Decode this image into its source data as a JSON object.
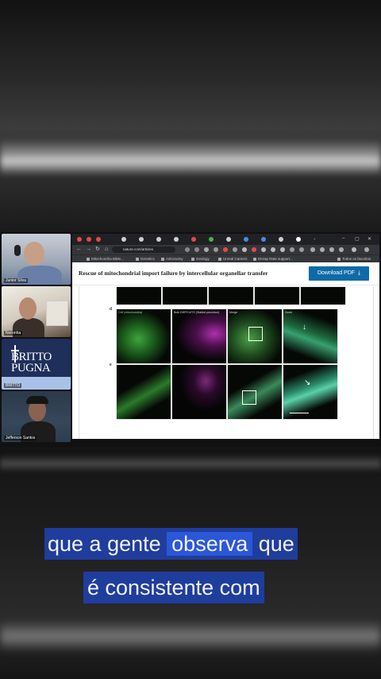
{
  "participants": [
    {
      "name": "Junior Silva"
    },
    {
      "name": "Noronha"
    },
    {
      "name": "BRITTO",
      "logo_lines": [
        "BRITTO",
        "PUGNA"
      ]
    },
    {
      "name": "Jefferson Santos"
    }
  ],
  "browser": {
    "url": "nature.com/articles",
    "window_controls": {
      "minimize": "–",
      "maximize": "▢",
      "close": "✕"
    },
    "bookmarks": [
      "Mitochondria Bible...",
      "Genetics",
      "Astronomy",
      "Geology",
      "Unreal Careers",
      "Decap Rate support...",
      "Todos os favoritos"
    ]
  },
  "article": {
    "title": "Rescue of mitochondrial import failure by intercellular organellar transfer",
    "download_button": "Download PDF",
    "figure": {
      "row_letters": [
        "d",
        "e"
      ],
      "captions": [
        "Cell (mitochondria)",
        "Bulk DHFR-MTS (Stalled precursor)",
        "Merge",
        "Zoom"
      ]
    }
  },
  "subtitles": {
    "line1_before": "que a gente",
    "line1_highlight": "observa",
    "line1_after": "que",
    "line2": "é consistente com"
  },
  "colors": {
    "subtitle_bg": "#1f3d9c",
    "subtitle_highlight": "#2b57d8",
    "pdf_button": "#0e6ba8"
  }
}
